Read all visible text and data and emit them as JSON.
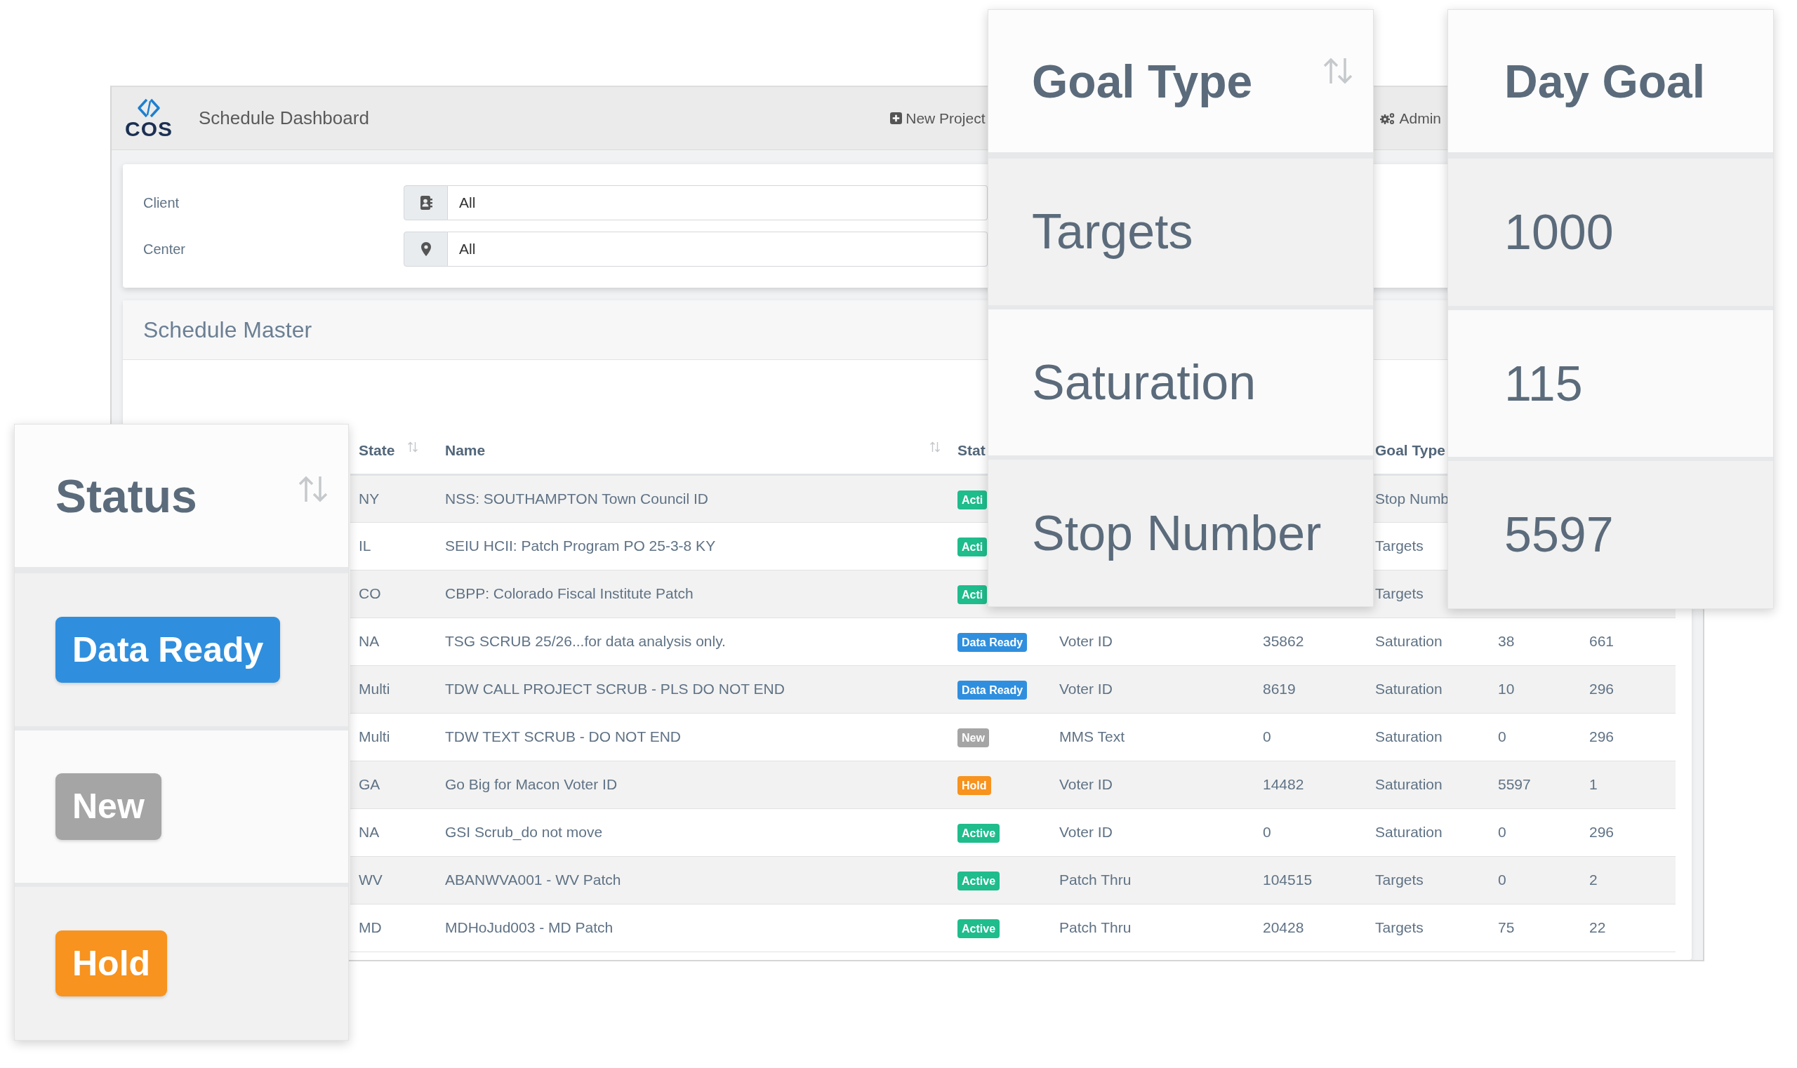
{
  "app_header": {
    "logo": "COS",
    "title": "Schedule Dashboard",
    "menu": [
      {
        "label": "New Project"
      },
      {
        "label": "Admin"
      }
    ]
  },
  "filters": [
    {
      "label": "Client",
      "value": "All"
    },
    {
      "label": "Center",
      "value": "All"
    }
  ],
  "schedule_master": {
    "title": "Schedule Master",
    "columns": [
      {
        "label": "State",
        "sort": true
      },
      {
        "label": "Name",
        "sort": true
      },
      {
        "label": "Stat"
      },
      {},
      {},
      {
        "label": "Goal Type"
      },
      {},
      {}
    ],
    "rows": [
      {
        "state": "NY",
        "name": "NSS: SOUTHAMPTON Town Council ID",
        "status": {
          "label": "Acti",
          "kind": "active"
        },
        "goal_type": "Stop Numb"
      },
      {
        "state": "IL",
        "name": "SEIU HCII: Patch Program PO 25-3-8 KY",
        "status": {
          "label": "Acti",
          "kind": "active"
        },
        "goal_type": "Targets"
      },
      {
        "state": "CO",
        "name": "CBPP: Colorado Fiscal Institute Patch",
        "status": {
          "label": "Acti",
          "kind": "active"
        },
        "goal_type": "Targets"
      },
      {
        "state": "NA",
        "name": "TSG SCRUB 25/26...for data analysis only.",
        "status": {
          "label": "Data Ready",
          "kind": "data_ready"
        },
        "column_4": "Voter ID",
        "column_5": "35862",
        "goal_type": "Saturation",
        "day_goal": "38",
        "column_8": "661"
      },
      {
        "state": "Multi",
        "name": "TDW CALL PROJECT SCRUB - PLS DO NOT END",
        "status": {
          "label": "Data Ready",
          "kind": "data_ready"
        },
        "column_4": "Voter ID",
        "column_5": "8619",
        "goal_type": "Saturation",
        "day_goal": "10",
        "column_8": "296"
      },
      {
        "state": "Multi",
        "name": "TDW TEXT SCRUB - DO NOT END",
        "status": {
          "label": "New",
          "kind": "new"
        },
        "column_4": "MMS Text",
        "column_5": "0",
        "goal_type": "Saturation",
        "day_goal": "0",
        "column_8": "296"
      },
      {
        "state": "GA",
        "name": "Go Big for Macon Voter ID",
        "status": {
          "label": "Hold",
          "kind": "hold"
        },
        "column_4": "Voter ID",
        "column_5": "14482",
        "goal_type": "Saturation",
        "day_goal": "5597",
        "column_8": "1"
      },
      {
        "state": "NA",
        "name": "GSI Scrub_do not move",
        "status": {
          "label": "Active",
          "kind": "active"
        },
        "column_4": "Voter ID",
        "column_5": "0",
        "goal_type": "Saturation",
        "day_goal": "0",
        "column_8": "296"
      },
      {
        "state": "WV",
        "name": "ABANWVA001 - WV Patch",
        "status": {
          "label": "Active",
          "kind": "active"
        },
        "column_4": "Patch Thru",
        "column_5": "104515",
        "goal_type": "Targets",
        "day_goal": "0",
        "column_8": "2"
      },
      {
        "state": "MD",
        "name": "MDHoJud003 - MD Patch",
        "status": {
          "label": "Active",
          "kind": "active"
        },
        "column_4": "Patch Thru",
        "column_5": "20428",
        "goal_type": "Targets",
        "day_goal": "75",
        "column_8": "22"
      }
    ]
  },
  "callouts": [
    {
      "header": "Status",
      "sort": true,
      "items": [
        {
          "kind": "data_ready",
          "label": "Data Ready"
        },
        {
          "kind": "new",
          "label": "New"
        },
        {
          "kind": "hold",
          "label": "Hold"
        }
      ]
    },
    {
      "header": "Goal Type",
      "sort": true,
      "items": [
        {
          "kind": "text",
          "label": "Targets"
        },
        {
          "kind": "text",
          "label": "Saturation"
        },
        {
          "kind": "text",
          "label": "Stop Number"
        }
      ]
    },
    {
      "header": "Day Goal",
      "items": [
        {
          "kind": "text",
          "label": "1000"
        },
        {
          "kind": "text",
          "label": "115"
        },
        {
          "kind": "text",
          "label": "5597"
        }
      ]
    }
  ]
}
